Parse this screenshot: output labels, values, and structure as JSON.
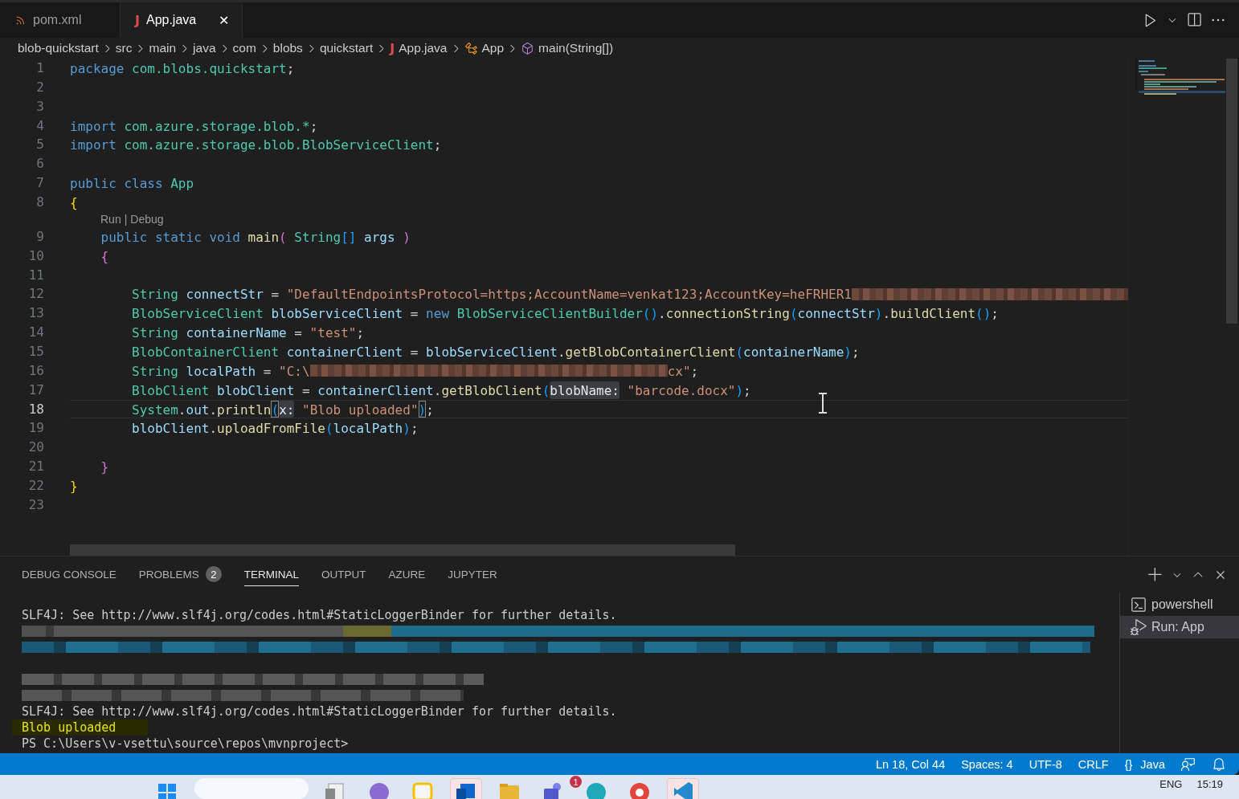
{
  "tabs": [
    {
      "label": "pom.xml",
      "kind": "xml",
      "selected": false
    },
    {
      "label": "App.java",
      "kind": "java",
      "glyph": "J",
      "selected": true,
      "close": "✕"
    }
  ],
  "breadcrumbs": [
    {
      "label": "blob-quickstart",
      "kind": "folder"
    },
    {
      "label": "src",
      "kind": "folder"
    },
    {
      "label": "main",
      "kind": "folder"
    },
    {
      "label": "java",
      "kind": "folder"
    },
    {
      "label": "com",
      "kind": "folder"
    },
    {
      "label": "blobs",
      "kind": "folder"
    },
    {
      "label": "quickstart",
      "kind": "folder"
    },
    {
      "label": "App.java",
      "kind": "java",
      "glyph": "J"
    },
    {
      "label": "App",
      "kind": "class"
    },
    {
      "label": "main(String[])",
      "kind": "method"
    }
  ],
  "editor": {
    "rows": [
      {
        "kind": "code",
        "number": "1",
        "current": false,
        "tokens": [
          {
            "text": "package",
            "kind": "keyword"
          },
          {
            "text": " com.blobs.quickstart",
            "kind": "type"
          },
          {
            "text": ";",
            "kind": "plain"
          }
        ]
      },
      {
        "kind": "code",
        "number": "2",
        "current": false
      },
      {
        "kind": "code",
        "number": "3",
        "current": false
      },
      {
        "kind": "code",
        "number": "4",
        "current": false,
        "tokens": [
          {
            "text": "import",
            "kind": "keyword"
          },
          {
            "text": " com.azure.storage.blob.*",
            "kind": "type"
          },
          {
            "text": ";",
            "kind": "plain"
          }
        ]
      },
      {
        "kind": "code",
        "number": "5",
        "current": false,
        "tokens": [
          {
            "text": "import",
            "kind": "keyword"
          },
          {
            "text": " com.azure.storage.blob.BlobServiceClient",
            "kind": "type"
          },
          {
            "text": ";",
            "kind": "plain"
          }
        ]
      },
      {
        "kind": "code",
        "number": "6",
        "current": false
      },
      {
        "kind": "code",
        "number": "7",
        "current": false,
        "tokens": [
          {
            "text": "public class",
            "kind": "keyword"
          },
          {
            "text": " App",
            "kind": "type"
          }
        ]
      },
      {
        "kind": "code",
        "number": "8",
        "current": false,
        "tokens": [
          {
            "text": "{",
            "kind": "bracket1"
          }
        ]
      },
      {
        "kind": "codelens",
        "links": [
          "Run",
          "Debug"
        ],
        "separator": "|"
      },
      {
        "kind": "code",
        "number": "9",
        "current": false,
        "tokens": [
          {
            "text": "    public static void",
            "kind": "keyword"
          },
          {
            "text": " main",
            "kind": "func"
          },
          {
            "text": "(",
            "kind": "bracket2"
          },
          {
            "text": " String",
            "kind": "type"
          },
          {
            "text": "[]",
            "kind": "bracket3"
          },
          {
            "text": " args",
            "kind": "var"
          },
          {
            "text": " )",
            "kind": "bracket2"
          }
        ]
      },
      {
        "kind": "code",
        "number": "10",
        "current": false,
        "tokens": [
          {
            "text": "    {",
            "kind": "bracket2"
          }
        ]
      },
      {
        "kind": "code",
        "number": "11",
        "current": false
      },
      {
        "kind": "code",
        "number": "12",
        "current": false,
        "tokens": [
          {
            "text": "        String",
            "kind": "type"
          },
          {
            "text": " connectStr",
            "kind": "var"
          },
          {
            "text": " =",
            "kind": "plain"
          },
          {
            "text": " \"DefaultEndpointsProtocol=https;AccountName=venkat123;AccountKey=heFRHER1",
            "kind": "string"
          },
          {
            "kind": "redacted-tail"
          }
        ]
      },
      {
        "kind": "code",
        "number": "13",
        "current": false,
        "tokens": [
          {
            "text": "        BlobServiceClient",
            "kind": "type"
          },
          {
            "text": " blobServiceClient",
            "kind": "var"
          },
          {
            "text": " =",
            "kind": "plain"
          },
          {
            "text": " new",
            "kind": "keyword"
          },
          {
            "text": " BlobServiceClientBuilder",
            "kind": "type"
          },
          {
            "text": "()",
            "kind": "bracket3"
          },
          {
            "text": ".",
            "kind": "plain"
          },
          {
            "text": "connectionString",
            "kind": "func"
          },
          {
            "text": "(",
            "kind": "bracket3"
          },
          {
            "text": "connectStr",
            "kind": "var"
          },
          {
            "text": ")",
            "kind": "bracket3"
          },
          {
            "text": ".",
            "kind": "plain"
          },
          {
            "text": "buildClient",
            "kind": "func"
          },
          {
            "text": "()",
            "kind": "bracket3"
          },
          {
            "text": ";",
            "kind": "plain"
          }
        ]
      },
      {
        "kind": "code",
        "number": "14",
        "current": false,
        "tokens": [
          {
            "text": "        String",
            "kind": "type"
          },
          {
            "text": " containerName",
            "kind": "var"
          },
          {
            "text": " =",
            "kind": "plain"
          },
          {
            "text": " \"test\"",
            "kind": "string"
          },
          {
            "text": ";",
            "kind": "plain"
          }
        ]
      },
      {
        "kind": "code",
        "number": "15",
        "current": false,
        "tokens": [
          {
            "text": "        BlobContainerClient",
            "kind": "type"
          },
          {
            "text": " containerClient",
            "kind": "var"
          },
          {
            "text": " =",
            "kind": "plain"
          },
          {
            "text": " blobServiceClient",
            "kind": "var"
          },
          {
            "text": ".",
            "kind": "plain"
          },
          {
            "text": "getBlobContainerClient",
            "kind": "func"
          },
          {
            "text": "(",
            "kind": "bracket3"
          },
          {
            "text": "containerName",
            "kind": "var"
          },
          {
            "text": ")",
            "kind": "bracket3"
          },
          {
            "text": ";",
            "kind": "plain"
          }
        ]
      },
      {
        "kind": "code",
        "number": "16",
        "current": false,
        "tokens": [
          {
            "text": "        String",
            "kind": "type"
          },
          {
            "text": " localPath",
            "kind": "var"
          },
          {
            "text": " =",
            "kind": "plain"
          },
          {
            "text": " \"C:\\",
            "kind": "string"
          },
          {
            "kind": "redacted-mid"
          },
          {
            "text": "cx\"",
            "kind": "string"
          },
          {
            "text": ";",
            "kind": "plain"
          }
        ]
      },
      {
        "kind": "code",
        "number": "17",
        "current": false,
        "tokens": [
          {
            "text": "        BlobClient",
            "kind": "type"
          },
          {
            "text": " blobClient",
            "kind": "var"
          },
          {
            "text": " =",
            "kind": "plain"
          },
          {
            "text": " containerClient",
            "kind": "var"
          },
          {
            "text": ".",
            "kind": "plain"
          },
          {
            "text": "getBlobClient",
            "kind": "func"
          },
          {
            "text": "(",
            "kind": "bracket3"
          },
          {
            "text": "blobName:",
            "kind": "hint"
          },
          {
            "text": " \"barcode.docx\"",
            "kind": "string"
          },
          {
            "text": ")",
            "kind": "bracket3"
          },
          {
            "text": ";",
            "kind": "plain"
          }
        ]
      },
      {
        "kind": "code",
        "number": "18",
        "current": true,
        "tokens": [
          {
            "text": "        System",
            "kind": "type"
          },
          {
            "text": ".",
            "kind": "plain"
          },
          {
            "text": "out",
            "kind": "var"
          },
          {
            "text": ".",
            "kind": "plain"
          },
          {
            "text": "println",
            "kind": "func"
          },
          {
            "text": "(",
            "kind": "bracket-match"
          },
          {
            "text": "x:",
            "kind": "hint"
          },
          {
            "text": " \"Blob uploaded\"",
            "kind": "string"
          },
          {
            "text": ")",
            "kind": "bracket-match"
          },
          {
            "text": ";",
            "kind": "plain"
          }
        ]
      },
      {
        "kind": "code",
        "number": "19",
        "current": false,
        "tokens": [
          {
            "text": "        blobClient",
            "kind": "var"
          },
          {
            "text": ".",
            "kind": "plain"
          },
          {
            "text": "uploadFromFile",
            "kind": "func"
          },
          {
            "text": "(",
            "kind": "bracket3"
          },
          {
            "text": "localPath",
            "kind": "var"
          },
          {
            "text": ")",
            "kind": "bracket3"
          },
          {
            "text": ";",
            "kind": "plain"
          }
        ]
      },
      {
        "kind": "code",
        "number": "20",
        "current": false
      },
      {
        "kind": "code",
        "number": "21",
        "current": false,
        "tokens": [
          {
            "text": "    }",
            "kind": "bracket2"
          }
        ]
      },
      {
        "kind": "code",
        "number": "22",
        "current": false,
        "tokens": [
          {
            "text": "}",
            "kind": "bracket1"
          }
        ]
      },
      {
        "kind": "code",
        "number": "23",
        "current": false
      }
    ]
  },
  "panel": {
    "tabs": [
      {
        "label": "DEBUG CONSOLE",
        "selected": false
      },
      {
        "label": "PROBLEMS",
        "badge": "2",
        "selected": false
      },
      {
        "label": "TERMINAL",
        "selected": true
      },
      {
        "label": "OUTPUT",
        "selected": false
      },
      {
        "label": "AZURE",
        "selected": false
      },
      {
        "label": "JUPYTER",
        "selected": false
      }
    ],
    "terminal_lines": [
      {
        "kind": "text",
        "text": "SLF4J: See http://www.slf4j.org/codes.html#StaticLoggerBinder for further details."
      },
      {
        "kind": "redacted-mixed"
      },
      {
        "kind": "redacted-blue"
      },
      {
        "kind": "blank"
      },
      {
        "kind": "redacted-gray"
      },
      {
        "kind": "redacted-gray-short"
      },
      {
        "kind": "text",
        "text": "SLF4J: See http://www.slf4j.org/codes.html#StaticLoggerBinder for further details."
      },
      {
        "kind": "highlight",
        "text": "Blob uploaded"
      },
      {
        "kind": "text",
        "text": "PS C:\\Users\\v-vsettu\\source\\repos\\mvnproject>"
      }
    ],
    "terminals": [
      {
        "label": "powershell",
        "kind": "shell",
        "selected": false
      },
      {
        "label": "Run: App",
        "kind": "debug",
        "selected": true
      }
    ]
  },
  "status_bar": {
    "items": [
      {
        "label": "Ln 18, Col 44"
      },
      {
        "label": "Spaces: 4"
      },
      {
        "label": "UTF-8"
      },
      {
        "label": "CRLF"
      },
      {
        "label": "Java",
        "glyph": "{}"
      }
    ]
  },
  "taskbar": {
    "apps": [
      {
        "kind": "windows",
        "active": false
      },
      {
        "kind": "search"
      },
      {
        "kind": "files",
        "active": false
      },
      {
        "kind": "copilot",
        "active": false
      },
      {
        "kind": "notes",
        "active": false
      },
      {
        "kind": "mail",
        "active": true
      },
      {
        "kind": "folder",
        "active": false
      },
      {
        "kind": "teams",
        "active": false,
        "badge": "1"
      },
      {
        "kind": "edge",
        "active": false
      },
      {
        "kind": "chrome",
        "active": false
      },
      {
        "kind": "vscode",
        "active": true
      }
    ],
    "language": "ENG",
    "time": "15:19"
  }
}
